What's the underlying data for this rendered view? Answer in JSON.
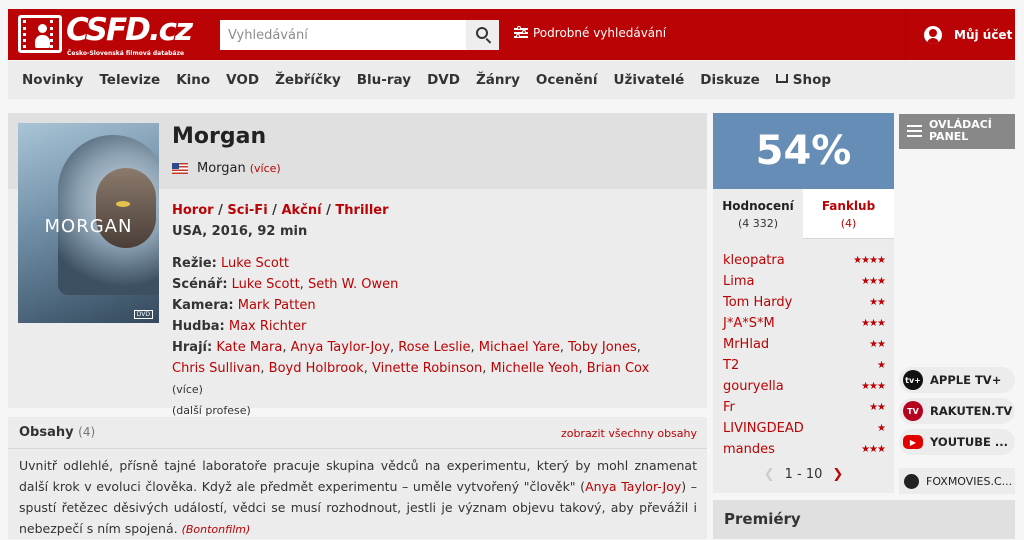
{
  "header": {
    "logo_text": "CSFD.cz",
    "logo_subtitle": "Česko-Slovenská filmová databáze",
    "search_placeholder": "Vyhledávání",
    "advanced_search": "Podrobné vyhledávání",
    "account": "Můj účet"
  },
  "nav": [
    "Novinky",
    "Televize",
    "Kino",
    "VOD",
    "Žebříčky",
    "Blu-ray",
    "DVD",
    "Žánry",
    "Ocenění",
    "Uživatelé",
    "Diskuze",
    "Shop"
  ],
  "film": {
    "title": "Morgan",
    "poster_title": "MORGAN",
    "poster_badge": "DVD",
    "original_title": "Morgan",
    "original_more": "(více)",
    "genres": [
      "Horor",
      "Sci-Fi",
      "Akční",
      "Thriller"
    ],
    "origin": "USA, 2016, 92 min",
    "credits": [
      {
        "label": "Režie:",
        "names": [
          "Luke Scott"
        ]
      },
      {
        "label": "Scénář:",
        "names": [
          "Luke Scott",
          "Seth W. Owen"
        ]
      },
      {
        "label": "Kamera:",
        "names": [
          "Mark Patten"
        ]
      },
      {
        "label": "Hudba:",
        "names": [
          "Max Richter"
        ]
      }
    ],
    "cast_label": "Hrají:",
    "cast": [
      "Kate Mara",
      "Anya Taylor-Joy",
      "Rose Leslie",
      "Michael Yare",
      "Toby Jones",
      "Chris Sullivan",
      "Boyd Holbrook",
      "Vinette Robinson",
      "Michelle Yeoh",
      "Brian Cox"
    ],
    "cast_more": "(více)",
    "more_professions": "(další profese)"
  },
  "plot": {
    "heading": "Obsahy",
    "count": "(4)",
    "show_all": "zobrazit všechny obsahy",
    "text_1": "Uvnitř odlehlé, přísně tajné laboratoře pracuje skupina vědců na experimentu, který by mohl znamenat další krok v evoluci člověka. Když ale předmět experimentu – uměle vytvořený \"člověk\" (",
    "text_link": "Anya Taylor-Joy",
    "text_2": ") – spustí řetězec děsivých událostí, vědci se musí rozhodnout, jestli je význam objevu takový, aby převážil i nebezpečí s ním spojená.",
    "source": "(Bontonfilm)"
  },
  "rating": {
    "score": "54%",
    "score_color": "#658db5",
    "tab_ratings": "Hodnocení",
    "tab_ratings_count": "(4 332)",
    "tab_fanclub": "Fanklub",
    "tab_fanclub_count": "(4)",
    "users": [
      {
        "name": "kleopatra",
        "stars": "★★★★"
      },
      {
        "name": "Lima",
        "stars": "★★★"
      },
      {
        "name": "Tom Hardy",
        "stars": "★★"
      },
      {
        "name": "J*A*S*M",
        "stars": "★★★"
      },
      {
        "name": "MrHlad",
        "stars": "★★"
      },
      {
        "name": "T2",
        "stars": "★"
      },
      {
        "name": "gouryella",
        "stars": "★★★"
      },
      {
        "name": "Fr",
        "stars": "★★"
      },
      {
        "name": "LIVINGDEAD",
        "stars": "★"
      },
      {
        "name": "mandes",
        "stars": "★★★"
      }
    ],
    "pager": "1 - 10"
  },
  "sidebar": {
    "panel_button": "OVLÁDACÍ PANEL",
    "vod": [
      {
        "label": "APPLE TV+",
        "icon": "tv+",
        "color": "#111111"
      },
      {
        "label": "RAKUTEN.TV",
        "icon": "TV",
        "color": "#b5001f"
      },
      {
        "label": "YOUTUBE ...",
        "icon": "▶",
        "color": "#e00000"
      }
    ],
    "foxmovies": "FOXMOVIES.C..."
  },
  "premiery": "Premiéry",
  "colors": {
    "brand": "#ba0305",
    "rating_blue": "#658db5"
  }
}
